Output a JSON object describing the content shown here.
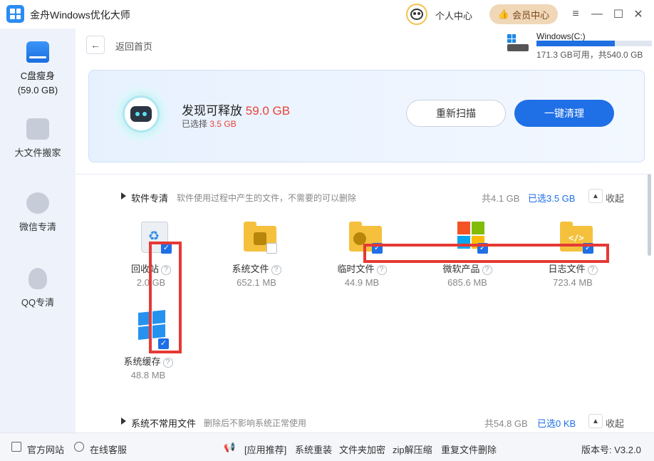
{
  "app": {
    "title": "金舟Windows优化大师"
  },
  "header": {
    "personal_center": "个人中心",
    "vip_label": "会员中心"
  },
  "window_controls": {
    "menu": "≡",
    "minimize": "—",
    "maximize": "☐",
    "close": "✕"
  },
  "sidebar": {
    "items": [
      {
        "label": "C盘瘦身",
        "sub": "(59.0 GB)",
        "icon": "disk-icon",
        "active": true
      },
      {
        "label": "大文件搬家",
        "icon": "box-icon"
      },
      {
        "label": "微信专清",
        "icon": "wechat-icon"
      },
      {
        "label": "QQ专清",
        "icon": "qq-icon"
      }
    ]
  },
  "nav": {
    "back_label": "返回首页"
  },
  "drive": {
    "name": "Windows(C:)",
    "info": "171.3 GB可用，共540.0 GB",
    "used_fraction": 0.68
  },
  "hero": {
    "title_prefix": "发现可释放 ",
    "title_value": "59.0 GB",
    "sub_prefix": "已选择 ",
    "sub_value": "3.5 GB",
    "rescan": "重新扫描",
    "clean": "一键清理"
  },
  "sections": [
    {
      "title": "软件专清",
      "desc": "软件使用过程中产生的文件，不需要的可以删除",
      "total": "共4.1 GB",
      "selected": "已选3.5 GB",
      "collapse": "收起",
      "items": [
        {
          "name": "回收站",
          "size": "2.0 GB",
          "checked": true,
          "icon": "recycle-bin-icon"
        },
        {
          "name": "系统文件",
          "size": "652.1 MB",
          "checked": false,
          "icon": "settings-folder-icon"
        },
        {
          "name": "临时文件",
          "size": "44.9 MB",
          "checked": true,
          "icon": "clock-folder-icon"
        },
        {
          "name": "微软产品",
          "size": "685.6 MB",
          "checked": true,
          "icon": "microsoft-icon"
        },
        {
          "name": "日志文件",
          "size": "723.4 MB",
          "checked": true,
          "icon": "code-folder-icon"
        },
        {
          "name": "系统缓存",
          "size": "48.8 MB",
          "checked": true,
          "icon": "windows-cache-icon"
        }
      ]
    },
    {
      "title": "系统不常用文件",
      "desc": "删除后不影响系统正常使用",
      "total": "共54.8 GB",
      "selected": "已选0 KB",
      "collapse": "收起"
    }
  ],
  "footer": {
    "website": "官方网站",
    "support": "在线客服",
    "links": [
      "[应用推荐]",
      "系统重装",
      "文件夹加密",
      "zip解压缩",
      "重复文件删除"
    ],
    "version": "版本号: V3.2.0"
  },
  "colors": {
    "accent": "#1f6fe6",
    "highlight": "#e8443a",
    "annotation": "#e53935"
  }
}
